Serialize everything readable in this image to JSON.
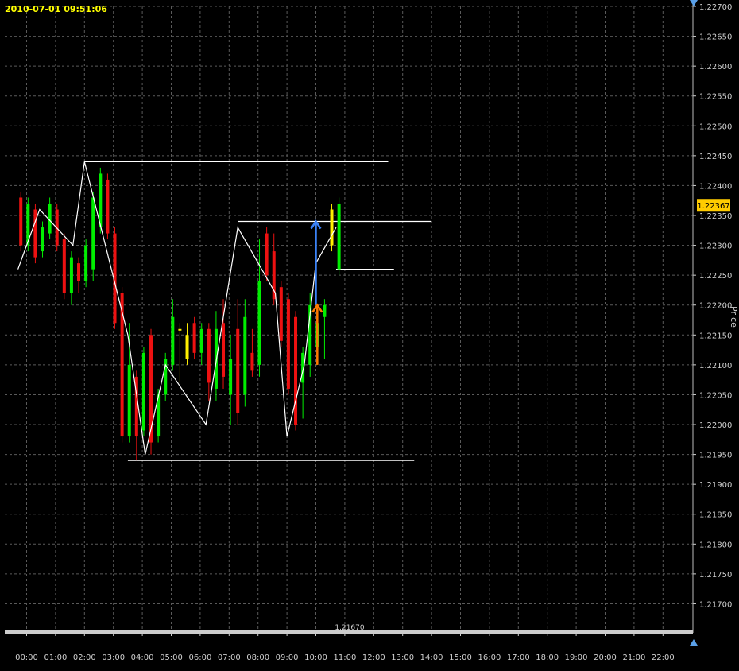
{
  "header": {
    "timestamp": "2010-07-01 09:51:06"
  },
  "price_axis": {
    "title": "Price",
    "ticks": [
      "1.22700",
      "1.22650",
      "1.22600",
      "1.22550",
      "1.22500",
      "1.22450",
      "1.22400",
      "1.22350",
      "1.22300",
      "1.22250",
      "1.22200",
      "1.22150",
      "1.22100",
      "1.22050",
      "1.22000",
      "1.21950",
      "1.21900",
      "1.21850",
      "1.21800",
      "1.21750",
      "1.21700"
    ],
    "current_price": "1.22367",
    "current_price_color": "#ffcc00"
  },
  "time_axis": {
    "ticks": [
      "00:00",
      "01:00",
      "02:00",
      "03:00",
      "04:00",
      "05:00",
      "06:00",
      "07:00",
      "08:00",
      "09:00",
      "10:00",
      "11:00",
      "12:00",
      "13:00",
      "14:00",
      "15:00",
      "16:00",
      "17:00",
      "18:00",
      "19:00",
      "20:00",
      "21:00",
      "22:00"
    ]
  },
  "bottom_line_label": "1.21670",
  "colors": {
    "up": "#00ee00",
    "down": "#ee1111",
    "neutral": "#ffee00",
    "grid": "#5a5a5a",
    "zigzag": "#ffffff",
    "arrow_up": "#3b82f6",
    "arrow_orange": "#ff7a00"
  },
  "chart_data": {
    "type": "bar",
    "title": "",
    "xlabel": "",
    "ylabel": "Price",
    "ylim": [
      1.2166,
      1.2271
    ],
    "x_unit": "hours",
    "bars": [
      {
        "t": -0.2,
        "o": 1.2238,
        "c": 1.223,
        "h": 1.2239,
        "l": 1.2229
      },
      {
        "t": 0.05,
        "o": 1.223,
        "c": 1.2237,
        "h": 1.2238,
        "l": 1.2229
      },
      {
        "t": 0.3,
        "o": 1.2236,
        "c": 1.2228,
        "h": 1.2237,
        "l": 1.2227
      },
      {
        "t": 0.55,
        "o": 1.2229,
        "c": 1.2233,
        "h": 1.2234,
        "l": 1.2228
      },
      {
        "t": 0.8,
        "o": 1.2232,
        "c": 1.2237,
        "h": 1.2238,
        "l": 1.2231
      },
      {
        "t": 1.05,
        "o": 1.2236,
        "c": 1.223,
        "h": 1.2237,
        "l": 1.2229
      },
      {
        "t": 1.3,
        "o": 1.2231,
        "c": 1.2222,
        "h": 1.2232,
        "l": 1.2221
      },
      {
        "t": 1.55,
        "o": 1.2222,
        "c": 1.2228,
        "h": 1.2229,
        "l": 1.222
      },
      {
        "t": 1.8,
        "o": 1.2227,
        "c": 1.2224,
        "h": 1.2228,
        "l": 1.2222
      },
      {
        "t": 2.05,
        "o": 1.2224,
        "c": 1.223,
        "h": 1.2231,
        "l": 1.2223
      },
      {
        "t": 2.3,
        "o": 1.2226,
        "c": 1.2238,
        "h": 1.2239,
        "l": 1.2224
      },
      {
        "t": 2.55,
        "o": 1.2233,
        "c": 1.2242,
        "h": 1.2243,
        "l": 1.2232
      },
      {
        "t": 2.8,
        "o": 1.2241,
        "c": 1.2232,
        "h": 1.2242,
        "l": 1.2231
      },
      {
        "t": 3.05,
        "o": 1.2232,
        "c": 1.2217,
        "h": 1.2233,
        "l": 1.2216
      },
      {
        "t": 3.3,
        "o": 1.2222,
        "c": 1.2198,
        "h": 1.2223,
        "l": 1.2197
      },
      {
        "t": 3.55,
        "o": 1.2198,
        "c": 1.221,
        "h": 1.2217,
        "l": 1.2197
      },
      {
        "t": 3.8,
        "o": 1.2208,
        "c": 1.2198,
        "h": 1.2209,
        "l": 1.2194
      },
      {
        "t": 4.05,
        "o": 1.2199,
        "c": 1.2212,
        "h": 1.2213,
        "l": 1.2198
      },
      {
        "t": 4.3,
        "o": 1.2215,
        "c": 1.2197,
        "h": 1.2216,
        "l": 1.2195
      },
      {
        "t": 4.55,
        "o": 1.2198,
        "c": 1.2205,
        "h": 1.2206,
        "l": 1.2197
      },
      {
        "t": 4.8,
        "o": 1.2205,
        "c": 1.2211,
        "h": 1.2212,
        "l": 1.2204
      },
      {
        "t": 5.05,
        "o": 1.221,
        "c": 1.2218,
        "h": 1.2221,
        "l": 1.2209
      },
      {
        "t": 5.3,
        "o": 1.2216,
        "c": 1.2216,
        "h": 1.2217,
        "l": 1.2207,
        "n": true
      },
      {
        "t": 5.55,
        "o": 1.2211,
        "c": 1.2215,
        "h": 1.2217,
        "l": 1.221,
        "n": true
      },
      {
        "t": 5.8,
        "o": 1.2217,
        "c": 1.2212,
        "h": 1.2218,
        "l": 1.2211
      },
      {
        "t": 6.05,
        "o": 1.2212,
        "c": 1.2216,
        "h": 1.2217,
        "l": 1.221
      },
      {
        "t": 6.3,
        "o": 1.2216,
        "c": 1.2207,
        "h": 1.2217,
        "l": 1.2204
      },
      {
        "t": 6.55,
        "o": 1.2206,
        "c": 1.2216,
        "h": 1.2219,
        "l": 1.2204
      },
      {
        "t": 6.8,
        "o": 1.2217,
        "c": 1.2208,
        "h": 1.2221,
        "l": 1.2206
      },
      {
        "t": 7.05,
        "o": 1.2205,
        "c": 1.2211,
        "h": 1.2215,
        "l": 1.22
      },
      {
        "t": 7.3,
        "o": 1.2216,
        "c": 1.2202,
        "h": 1.2221,
        "l": 1.22
      },
      {
        "t": 7.55,
        "o": 1.2205,
        "c": 1.2218,
        "h": 1.2221,
        "l": 1.2203
      },
      {
        "t": 7.8,
        "o": 1.2212,
        "c": 1.2209,
        "h": 1.2216,
        "l": 1.2208
      },
      {
        "t": 8.05,
        "o": 1.221,
        "c": 1.2224,
        "h": 1.2231,
        "l": 1.2208
      },
      {
        "t": 8.3,
        "o": 1.2232,
        "c": 1.2225,
        "h": 1.2233,
        "l": 1.2224
      },
      {
        "t": 8.55,
        "o": 1.2229,
        "c": 1.2221,
        "h": 1.2232,
        "l": 1.222
      },
      {
        "t": 8.8,
        "o": 1.2223,
        "c": 1.2214,
        "h": 1.2224,
        "l": 1.2213
      },
      {
        "t": 9.05,
        "o": 1.2221,
        "c": 1.2206,
        "h": 1.2222,
        "l": 1.2205
      },
      {
        "t": 9.3,
        "o": 1.2218,
        "c": 1.22,
        "h": 1.2219,
        "l": 1.2199
      },
      {
        "t": 9.55,
        "o": 1.2207,
        "c": 1.2212,
        "h": 1.2213,
        "l": 1.2201
      },
      {
        "t": 9.8,
        "o": 1.221,
        "c": 1.222,
        "h": 1.2222,
        "l": 1.2208
      },
      {
        "t": 10.05,
        "o": 1.2213,
        "c": 1.2217,
        "h": 1.2218,
        "l": 1.221
      },
      {
        "t": 10.3,
        "o": 1.2218,
        "c": 1.222,
        "h": 1.2221,
        "l": 1.2211
      },
      {
        "t": 10.55,
        "o": 1.223,
        "c": 1.2236,
        "h": 1.2237,
        "l": 1.2229,
        "n": true
      },
      {
        "t": 10.8,
        "o": 1.2226,
        "c": 1.2237,
        "h": 1.2238,
        "l": 1.2225
      }
    ],
    "zigzag": [
      [
        -0.3,
        1.2226
      ],
      [
        0.45,
        1.2236
      ],
      [
        1.6,
        1.223
      ],
      [
        2.0,
        1.2244
      ],
      [
        3.5,
        1.2215
      ],
      [
        4.1,
        1.2195
      ],
      [
        4.8,
        1.221
      ],
      [
        6.2,
        1.22
      ],
      [
        7.3,
        1.2233
      ],
      [
        8.6,
        1.2222
      ],
      [
        9.0,
        1.2198
      ],
      [
        9.6,
        1.221
      ],
      [
        10.0,
        1.2227
      ],
      [
        10.7,
        1.2233
      ]
    ],
    "levels": [
      {
        "x1": 2.0,
        "x2": 12.5,
        "y": 1.2244
      },
      {
        "x1": 7.3,
        "x2": 14.0,
        "y": 1.2234
      },
      {
        "x1": 10.7,
        "x2": 12.7,
        "y": 1.2226
      },
      {
        "x1": 3.5,
        "x2": 13.4,
        "y": 1.2194
      }
    ],
    "arrows": [
      {
        "x": 10.0,
        "y1": 1.222,
        "y2": 1.2234,
        "color": "arrow_up"
      },
      {
        "x": 10.05,
        "y1": 1.221,
        "y2": 1.222,
        "color": "arrow_orange"
      }
    ]
  }
}
